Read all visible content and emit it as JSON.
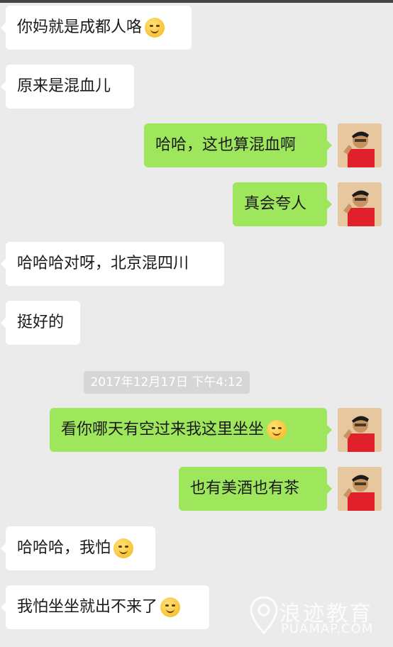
{
  "chat": {
    "messages": [
      {
        "side": "in",
        "text": "你妈就是成都人咯",
        "emoji": "smirk-emoji"
      },
      {
        "side": "in",
        "text": "原来是混血儿"
      },
      {
        "side": "out",
        "text": "哈哈，这也算混血啊"
      },
      {
        "side": "out",
        "text": "真会夸人"
      },
      {
        "side": "in",
        "text": "哈哈哈对呀，北京混四川"
      },
      {
        "side": "in",
        "text": "挺好的"
      },
      {
        "side": "out",
        "text": "看你哪天有空过来我这里坐坐",
        "emoji": "blush-emoji"
      },
      {
        "side": "out",
        "text": "也有美酒也有茶"
      },
      {
        "side": "in",
        "text": "哈哈哈，我怕",
        "emoji": "smile-emoji"
      },
      {
        "side": "in",
        "text": "我怕坐坐就出不来了",
        "emoji": "laugh-cry-emoji"
      }
    ],
    "timestamp": "2017年12月17日 下午4:12"
  },
  "watermark": {
    "title": "浪迹教育",
    "subtitle": "PUAMAP.COM",
    "icon": "location-pin-icon"
  },
  "colors": {
    "background": "#ebebeb",
    "incoming_bubble": "#ffffff",
    "outgoing_bubble": "#9ee65c"
  }
}
